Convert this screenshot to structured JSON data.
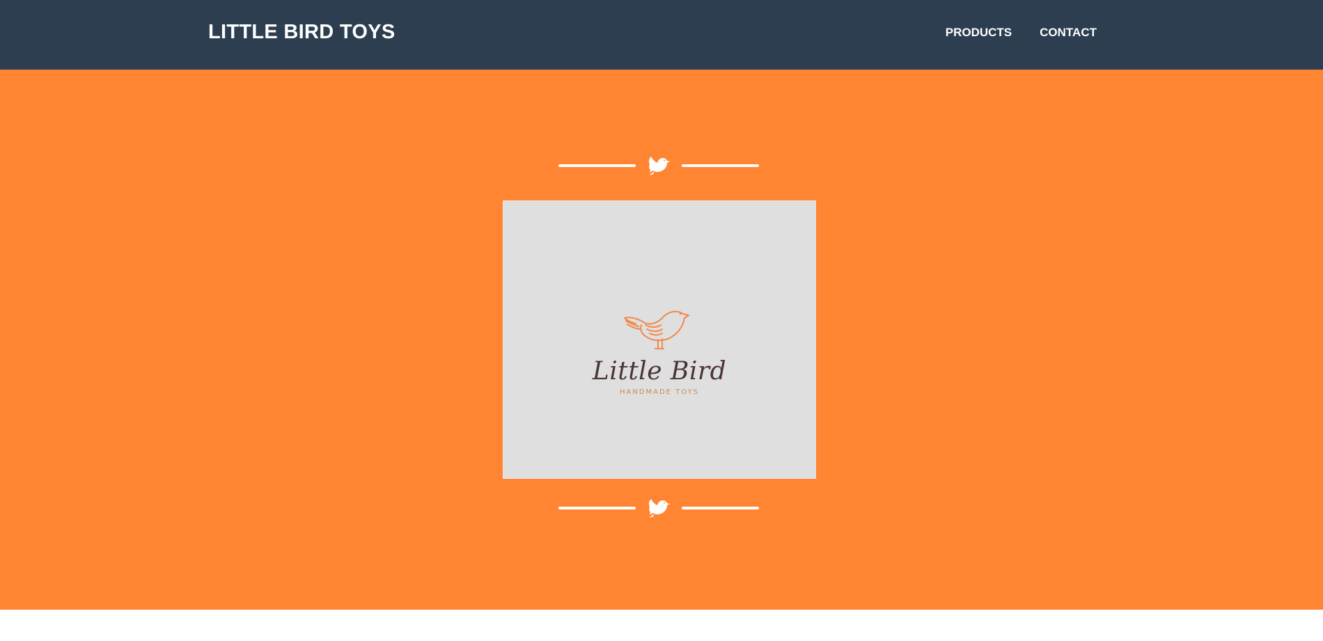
{
  "navbar": {
    "brand": "LITTLE BIRD TOYS",
    "links": [
      {
        "label": "PRODUCTS"
      },
      {
        "label": "CONTACT"
      }
    ]
  },
  "hero": {
    "logo": {
      "name": "Little Bird",
      "tagline": "HANDMADE TOYS"
    },
    "divider_icon": "bird-icon"
  },
  "colors": {
    "navbar_bg": "#2c3e50",
    "hero_bg": "#ff8533",
    "logo_card_bg": "#dfdfdf",
    "logo_bird": "#f2884b",
    "logo_text": "#4a3535",
    "tagline_text": "#c98a4e"
  }
}
